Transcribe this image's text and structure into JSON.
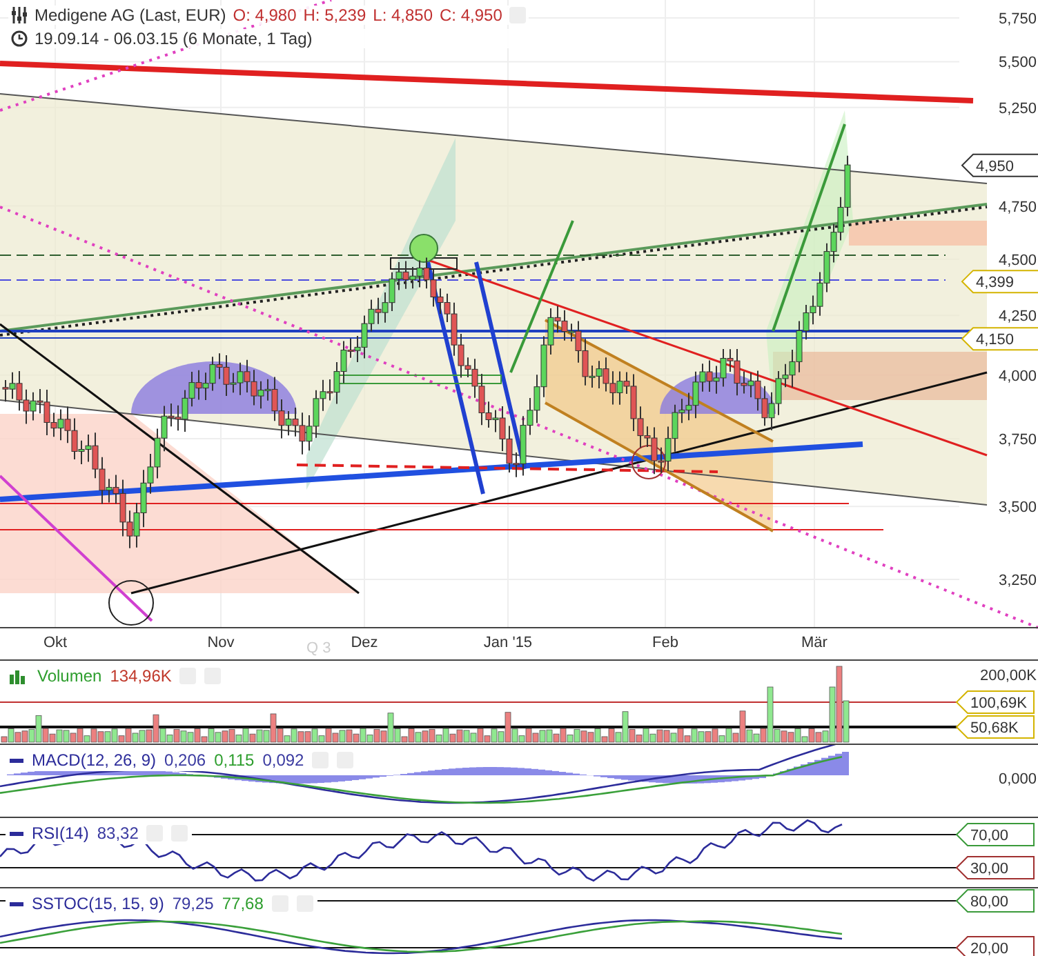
{
  "header": {
    "title": "Medigene AG (Last, EUR)",
    "ohlc": [
      "O: 4,980",
      "H: 5,239",
      "L: 4,850",
      "C: 4,950"
    ],
    "range": "19.09.14 - 06.03.15 (6 Monate, 1 Tag)"
  },
  "price_axis": {
    "ticks": [
      "5,750",
      "5,500",
      "5,250",
      "4,750",
      "4,500",
      "4,250",
      "4,000",
      "3,750",
      "3,500",
      "3,250"
    ],
    "markers": [
      {
        "label": "4,950",
        "color": "#333333"
      },
      {
        "label": "4,399",
        "color": "#d4b400"
      },
      {
        "label": "4,150",
        "color": "#d4b400"
      }
    ]
  },
  "time_axis": [
    "Okt",
    "Nov",
    "Dez",
    "Jan '15",
    "Feb",
    "Mär"
  ],
  "faint_label": "Q 3",
  "indicators": [
    {
      "kind": "volume",
      "name": "Volumen",
      "values": [
        {
          "text": "134,96K",
          "color": "#c0392b"
        }
      ],
      "ticks": [
        "200,00K"
      ],
      "markers": [
        {
          "label": "100,69K",
          "color": "#d4b400"
        },
        {
          "label": "50,68K",
          "color": "#d4b400"
        }
      ]
    },
    {
      "kind": "macd",
      "name": "MACD(12, 26, 9)",
      "values": [
        {
          "text": "0,206",
          "color": "#3a3aa0"
        },
        {
          "text": "0,115",
          "color": "#2e9e2e"
        },
        {
          "text": "0,092",
          "color": "#3a3aa0"
        }
      ],
      "ticks": [
        "0,000"
      ]
    },
    {
      "kind": "rsi",
      "name": "RSI(14)",
      "values": [
        {
          "text": "83,32",
          "color": "#3a3aa0"
        }
      ],
      "markers": [
        {
          "label": "70,00",
          "color": "#3a9a3a"
        },
        {
          "label": "30,00",
          "color": "#a03030"
        }
      ]
    },
    {
      "kind": "sstoc",
      "name": "SSTOC(15, 15, 9)",
      "values": [
        {
          "text": "79,25",
          "color": "#3a3aa0"
        },
        {
          "text": "77,68",
          "color": "#2e9e2e"
        }
      ],
      "markers": [
        {
          "label": "80,00",
          "color": "#3a9a3a"
        },
        {
          "label": "20,00",
          "color": "#a03030"
        }
      ]
    }
  ]
}
